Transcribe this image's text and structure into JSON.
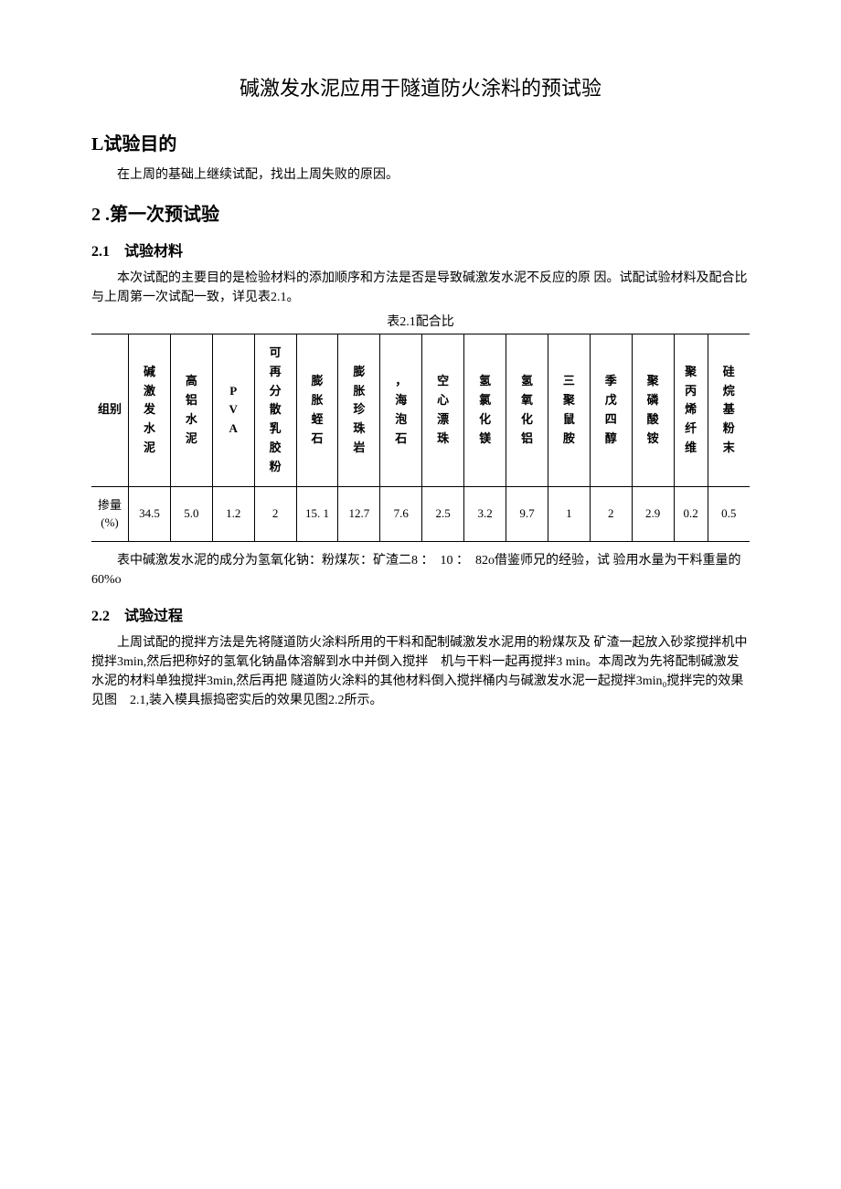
{
  "title": "碱激发水泥应用于隧道防火涂料的预试验",
  "section1": {
    "heading": "L试验目的",
    "p1": "在上周的基础上继续试配，找出上周失败的原因。"
  },
  "section2": {
    "heading": "2 .第一次预试验",
    "sub1": {
      "heading": "2.1　试验材料",
      "p1": "本次试配的主要目的是检验材料的添加顺序和方法是否是导致碱激发水泥不反应的原 因。试配试验材料及配合比与上周第一次试配一致，详见表2.1。",
      "table_caption": "表2.1配合比",
      "table": {
        "row_label1": "组别",
        "row_label2": "掺量(%)",
        "headers": [
          "碱激发水泥",
          "高铝水泥",
          "PVA",
          "可再分散乳胶粉",
          "膨胀蛭石",
          "膨胀珍珠岩",
          "，海泡石",
          "空心漂珠",
          "氢氯化镁",
          "氢氧化铝",
          "三聚鼠胺",
          "季戊四醇",
          "聚磷酸铵",
          "聚丙烯纤维",
          "硅烷基粉末"
        ],
        "values": [
          "34.5",
          "5.0",
          "1.2",
          "2",
          "15. 1",
          "12.7",
          "7.6",
          "2.5",
          "3.2",
          "9.7",
          "1",
          "2",
          "2.9",
          "0.2",
          "0.5"
        ]
      },
      "note": "表中碱激发水泥的成分为氢氧化钠：粉煤灰：矿渣二8 ：　10 ：　82o借鉴师兄的经验，试 验用水量为干料重量的60%o"
    },
    "sub2": {
      "heading": "2.2　试验过程",
      "p1": "上周试配的搅拌方法是先将隧道防火涂料所用的干料和配制碱激发水泥用的粉煤灰及 矿渣一起放入砂浆搅拌机中搅拌3min,然后把称好的氢氧化钠晶体溶解到水中并倒入搅拌　机与干料一起再搅拌3 min。本周改为先将配制碱激发水泥的材料单独搅拌3min,然后再把 隧道防火涂料的其他材料倒入搅拌桶内与碱激发水泥一起搅拌3min₀搅拌完的效果见图　2.1,装入模具振捣密实后的效果见图2.2所示。"
    }
  }
}
